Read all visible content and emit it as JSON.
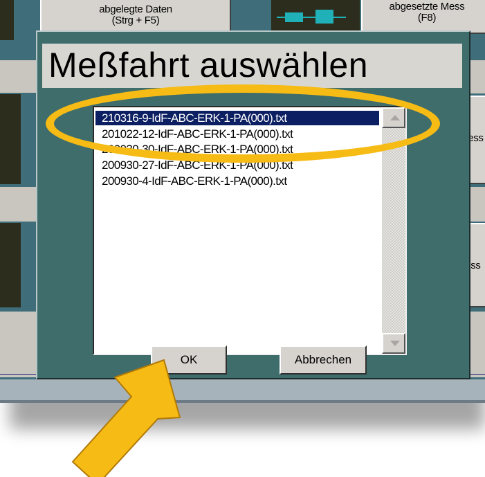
{
  "background_ui": {
    "top_button_1": {
      "line1": "abgelegte Daten",
      "line2": "(Strg + F5)"
    },
    "top_button_2": {
      "line1": "abgesetzte Mess",
      "line2": "(F8)"
    },
    "mid_label_1": "Mess",
    "mid_label_2": "Mess"
  },
  "dialog": {
    "title": "Meßfahrt auswählen",
    "files": [
      "210316-9-IdF-ABC-ERK-1-PA(000).txt",
      "201022-12-IdF-ABC-ERK-1-PA(000).txt",
      "200930-30-IdF-ABC-ERK-1-PA(000).txt",
      "200930-27-IdF-ABC-ERK-1-PA(000).txt",
      "200930-4-IdF-ABC-ERK-1-PA(000).txt"
    ],
    "selected_index": 0,
    "ok_label": "OK",
    "cancel_label": "Abbrechen"
  },
  "annotation": {
    "highlight_color": "#f6bb14",
    "arrow_color": "#f6bb14",
    "highlight_target": "selected file",
    "arrow_target": "OK button"
  }
}
